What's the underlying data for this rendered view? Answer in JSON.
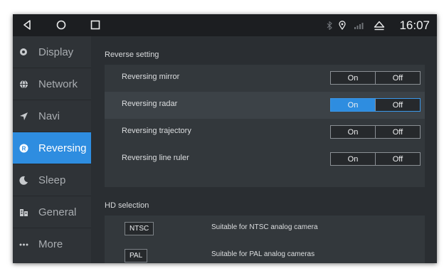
{
  "statusbar": {
    "nav_icons": [
      "back-icon",
      "home-icon",
      "recents-icon"
    ],
    "status_icons": [
      "bluetooth-icon",
      "location-icon",
      "signal-icon",
      "eject-icon"
    ],
    "time": "16:07"
  },
  "sidebar": {
    "items": [
      {
        "label": "Display",
        "icon": "display-icon",
        "active": false
      },
      {
        "label": "Network",
        "icon": "globe-icon",
        "active": false
      },
      {
        "label": "Navi",
        "icon": "navigation-arrow-icon",
        "active": false
      },
      {
        "label": "Reversing",
        "icon": "reverse-icon",
        "active": true
      },
      {
        "label": "Sleep",
        "icon": "moon-icon",
        "active": false
      },
      {
        "label": "General",
        "icon": "building-icon",
        "active": false
      },
      {
        "label": "More",
        "icon": "more-dots-icon",
        "active": false
      }
    ]
  },
  "reverse": {
    "title": "Reverse setting",
    "rows": [
      {
        "label": "Reversing mirror",
        "on": "On",
        "off": "Off",
        "selected": "off"
      },
      {
        "label": "Reversing radar",
        "on": "On",
        "off": "Off",
        "selected": "on"
      },
      {
        "label": "Reversing trajectory",
        "on": "On",
        "off": "Off",
        "selected": "off"
      },
      {
        "label": "Reversing line ruler",
        "on": "On",
        "off": "Off",
        "selected": "off"
      }
    ]
  },
  "hd": {
    "title": "HD selection",
    "options": [
      {
        "badge": "NTSC",
        "desc": "Suitable for NTSC analog camera"
      },
      {
        "badge": "PAL",
        "desc": "Suitable for PAL analog cameras"
      }
    ]
  },
  "colors": {
    "accent": "#2e8de0",
    "background": "#2a2e32",
    "statusbar": "#1c1e21"
  }
}
